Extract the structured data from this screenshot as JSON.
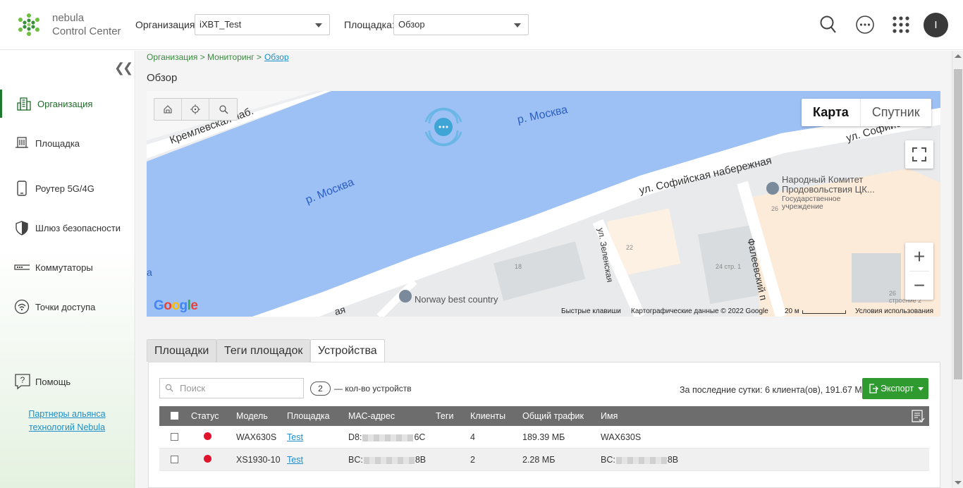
{
  "header": {
    "brand_line1": "nebula",
    "brand_line2": "Control Center",
    "org_label": "Организация:",
    "org_value": "iXBT_Test",
    "site_label": "Площадка:",
    "site_value": "Обзор",
    "avatar_initial": "I",
    "icons": [
      "search-icon",
      "more-icon",
      "apps-grid-icon"
    ]
  },
  "sidebar": {
    "items": [
      {
        "label": "Организация",
        "icon": "building-icon"
      },
      {
        "label": "Площадка",
        "icon": "site-icon"
      },
      {
        "label": "Роутер 5G/4G",
        "icon": "mobile-router-icon"
      },
      {
        "label": "Шлюз безопасности",
        "icon": "shield-icon"
      },
      {
        "label": "Коммутаторы",
        "icon": "switch-icon"
      },
      {
        "label": "Точки доступа",
        "icon": "wifi-ap-icon"
      }
    ],
    "help_label": "Помощь",
    "partners_line1": "Партнеры альянса",
    "partners_line2": "технологий Nebula"
  },
  "breadcrumb": {
    "path": "Организация > Мониторинг >",
    "current": "Обзор"
  },
  "page_title": "Обзор",
  "map": {
    "type_map": "Карта",
    "type_satellite": "Спутник",
    "labels": {
      "river1": "р. Москва",
      "river2": "р. Москва",
      "embankment": "ул. Софийская набережная",
      "sofia_short": "ул. Софийск",
      "kreml": "Кремлевская наб.",
      "zelenskaya": "ул. Зеленская",
      "faleevsky": "Фалеевский п",
      "poi1_name": "Народный Комитет",
      "poi1_name2": "Продовольствия ЦК...",
      "poi1_type1": "Государственное",
      "poi1_type2": "учреждение",
      "poi2_name": "Norway best country",
      "num_26": "26",
      "num_22": "22",
      "num_18": "18",
      "num_24": "24 стр. 1",
      "num_26b": "26",
      "num_26b_sub": "строение 2",
      "edge_a": "а",
      "edge_aya": "ая"
    },
    "attribution": {
      "shortcuts": "Быстрые клавиши",
      "data": "Картографические данные © 2022 Google",
      "scale": "20 м",
      "terms": "Условия использования"
    },
    "google": "Google"
  },
  "tabs": [
    {
      "label": "Площадки",
      "active": false
    },
    {
      "label": "Теги площадок",
      "active": false
    },
    {
      "label": "Устройства",
      "active": true
    }
  ],
  "devices": {
    "search_placeholder": "Поиск",
    "count": "2",
    "count_label": "— кол-во устройств",
    "summary": "За последние сутки: 6 клиента(ов), 191.67 МБ",
    "export_label": "Экспорт",
    "columns": [
      "Статус",
      "Модель",
      "Площадка",
      "МАС-адрес",
      "Теги",
      "Клиенты",
      "Общий трафик",
      "Имя"
    ],
    "rows": [
      {
        "status_color": "#e0152d",
        "model": "WAX630S",
        "site": "Test",
        "mac_start": "D8:",
        "mac_end": "6C",
        "tags": "",
        "clients": "4",
        "traffic": "189.39 МБ",
        "name": "WAX630S"
      },
      {
        "status_color": "#e0152d",
        "model": "XS1930-10",
        "site": "Test",
        "mac_start": "BC:",
        "mac_end": "8B",
        "tags": "",
        "clients": "2",
        "traffic": "2.28 МБ",
        "name_start": "BC:",
        "name_end": "8B"
      }
    ]
  },
  "colors": {
    "accent_green": "#2f9a2f",
    "status_offline": "#e0152d",
    "link_blue": "#1a8fc9",
    "water": "#9ec1f5"
  }
}
